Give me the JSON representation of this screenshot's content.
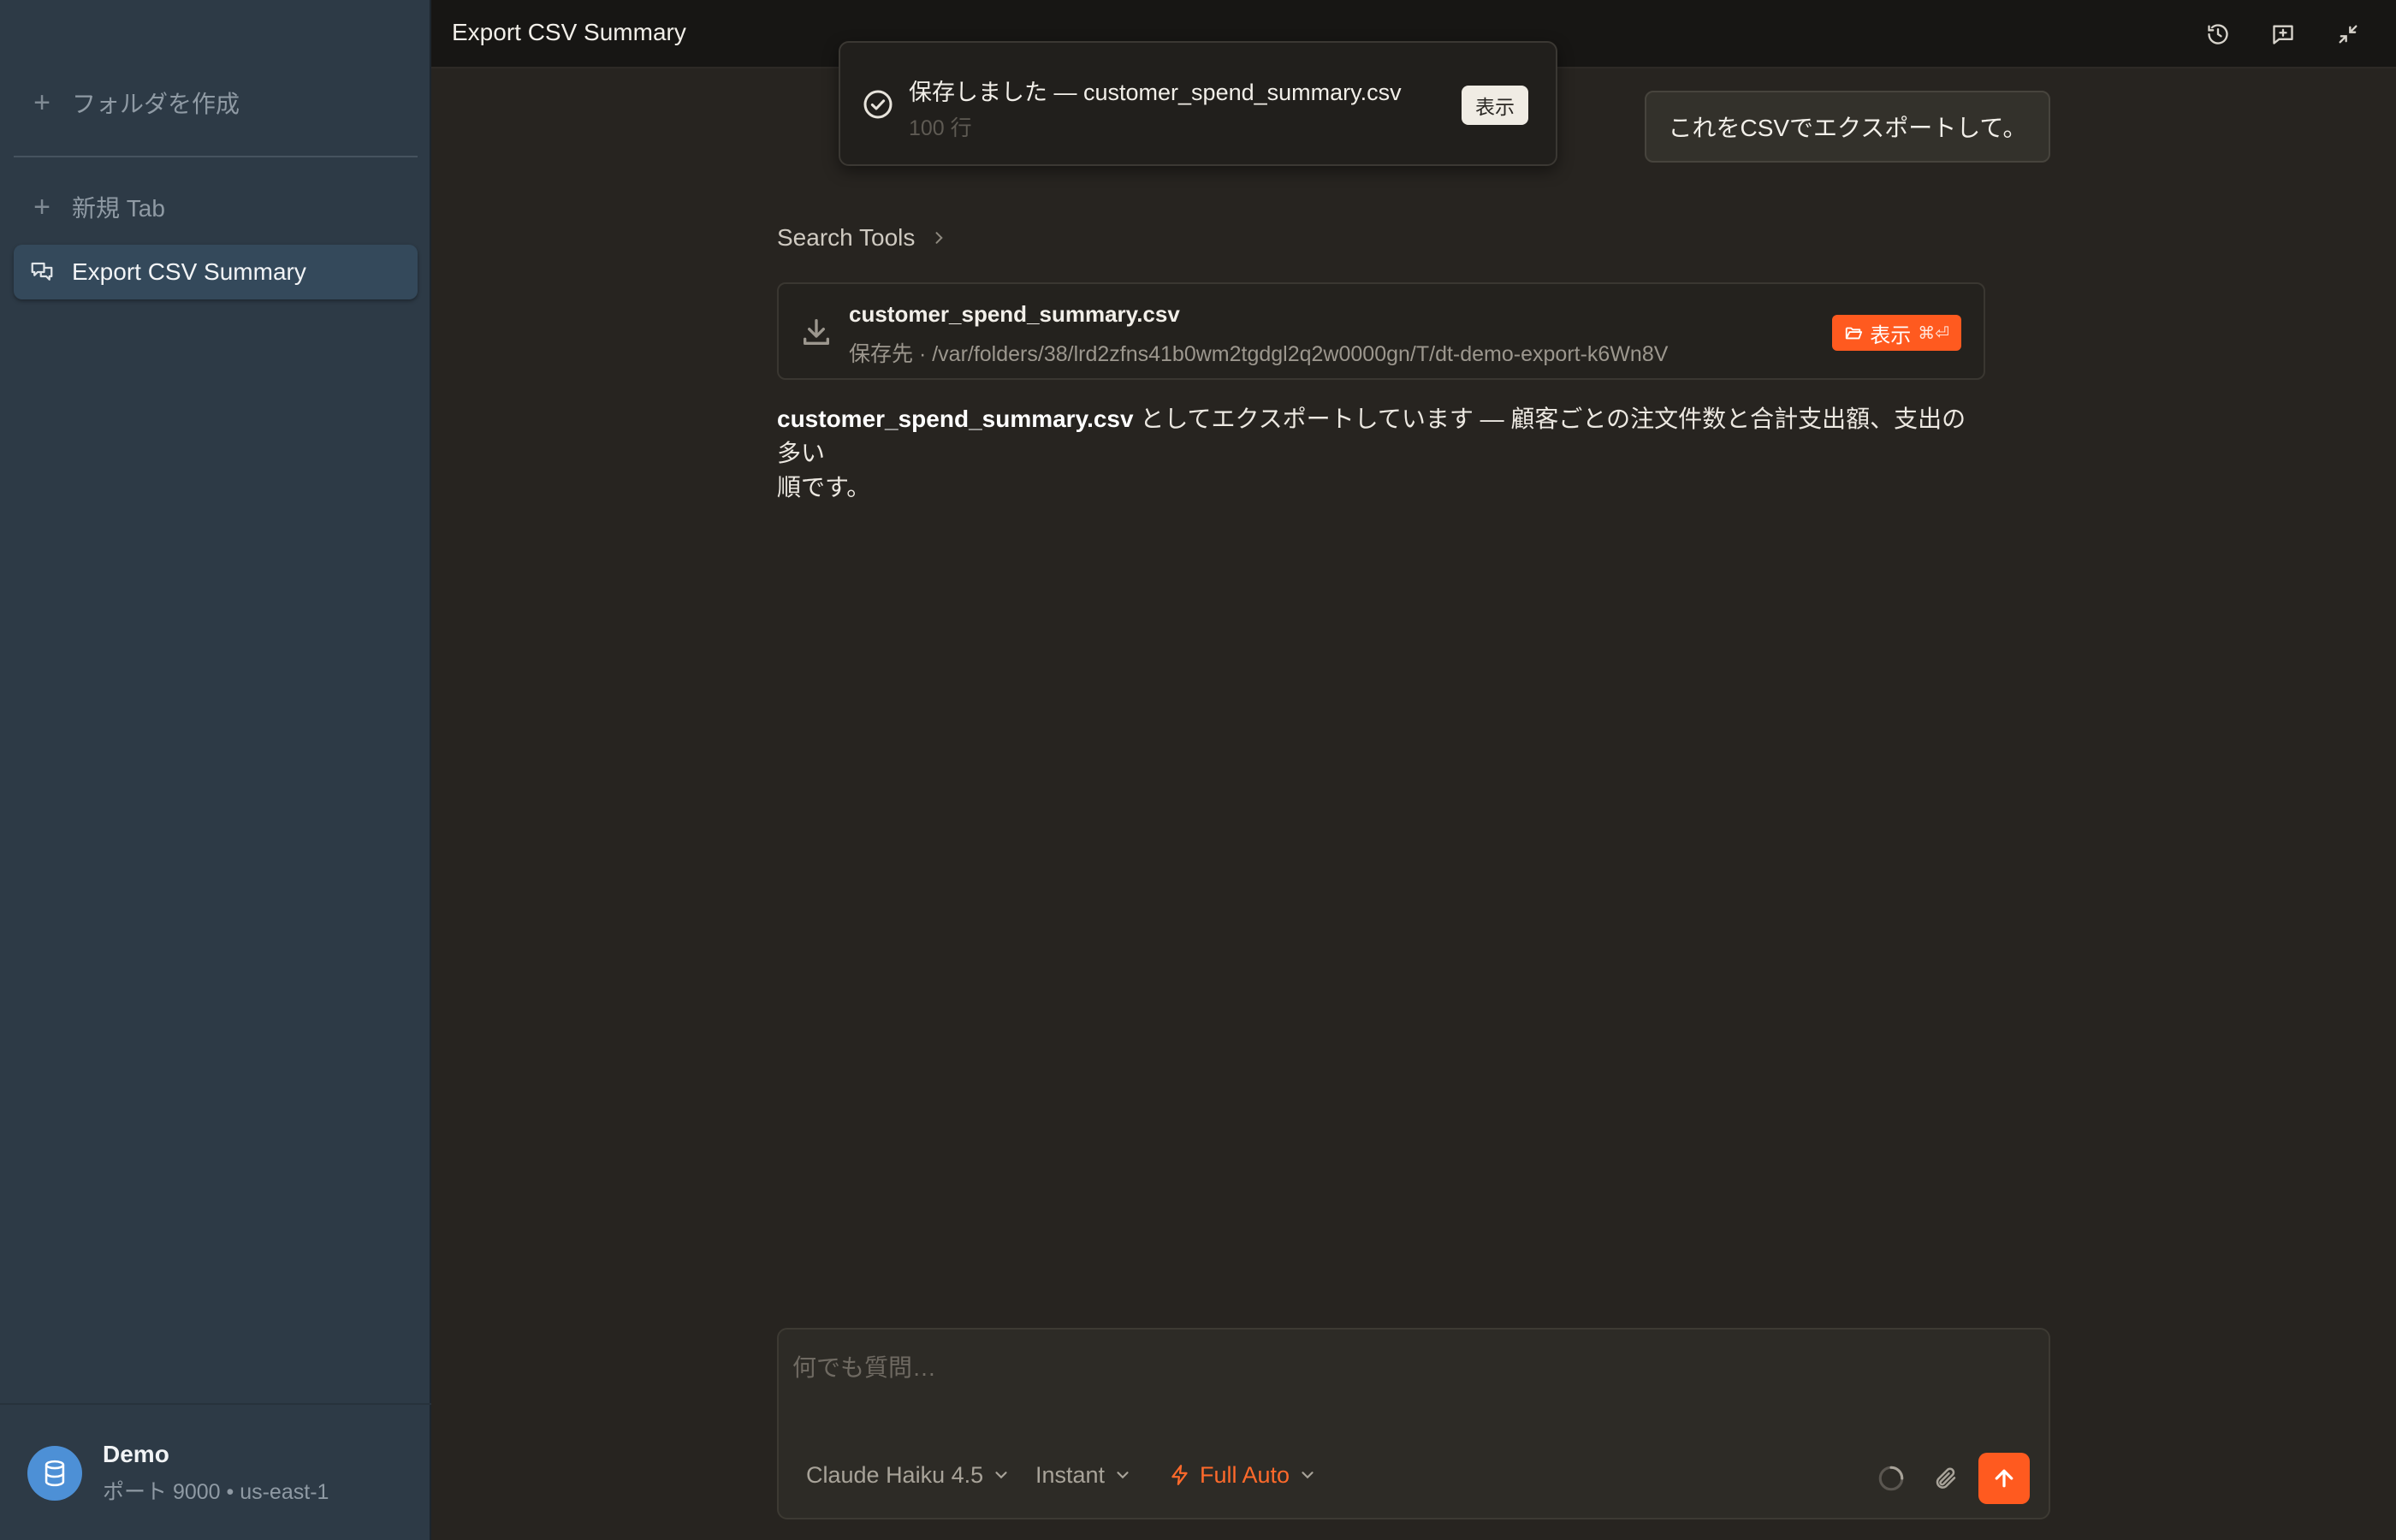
{
  "window": {
    "title": "Export CSV Summary"
  },
  "sidebar": {
    "create_folder": "フォルダを作成",
    "new_tab": "新規 Tab",
    "active_chat": "Export CSV Summary",
    "footer": {
      "name": "Demo",
      "details": "ポート 9000 • us-east-1"
    }
  },
  "toast": {
    "title": "保存しました — customer_spend_summary.csv",
    "subtitle": "100 行",
    "button": "表示"
  },
  "user_message": "これをCSVでエクスポートして。",
  "search_tools": {
    "label": "Search Tools"
  },
  "file_card": {
    "name": "customer_spend_summary.csv",
    "path": "保存先 · /var/folders/38/lrd2zfns41b0wm2tgdgl2q2w0000gn/T/dt-demo-export-k6Wn8V",
    "button": "表示",
    "shortcut": "⌘⏎"
  },
  "answer": {
    "filename": "customer_spend_summary.csv",
    "text_line1": " としてエクスポートしています — 顧客ごとの注文件数と合計支出額、支出の多い",
    "text_line2": "順です。"
  },
  "composer": {
    "placeholder": "何でも質問…",
    "model": "Claude Haiku 4.5",
    "speed": "Instant",
    "mode": "Full Auto"
  },
  "colors": {
    "accent": "#ff5a1f",
    "sidebar_bg": "#2d3a46",
    "main_bg": "#272420",
    "topbar_bg": "#171614"
  },
  "icons": {
    "topbar": [
      "history-icon",
      "new-chat-icon",
      "collapse-icon"
    ],
    "toast": "check-circle-icon",
    "file_card": "download-icon",
    "composer": [
      "spinner-icon",
      "paperclip-icon",
      "arrow-up-icon"
    ]
  }
}
